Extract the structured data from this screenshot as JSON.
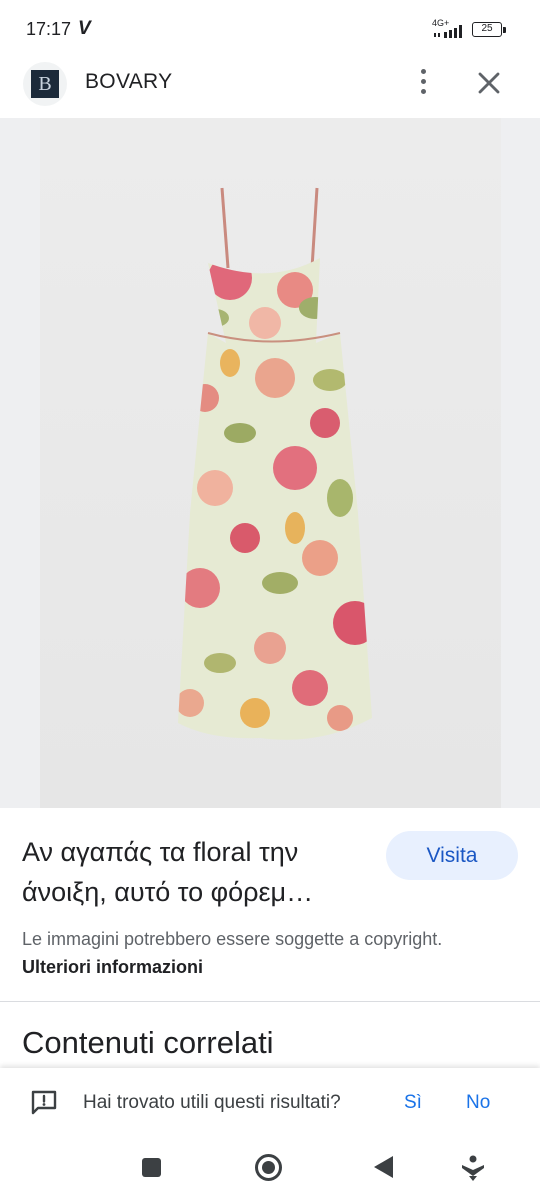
{
  "status": {
    "time": "17:17",
    "carrier_glyph": "V",
    "network": "4G+",
    "battery": "25"
  },
  "header": {
    "logo_letter": "B",
    "title": "BOVARY",
    "menu_icon": "more-vert-icon",
    "close_icon": "close-icon"
  },
  "result": {
    "caption": "Αν αγαπάς τα floral την άνοιξη, αυτό το φόρεμ…",
    "visit_label": "Visita",
    "copyright_text": "Le immagini potrebbero essere soggette a copyright.",
    "more_info_label": "Ulteriori informazioni"
  },
  "related": {
    "title": "Contenuti correlati"
  },
  "feedback": {
    "question": "Hai trovato utili questi risultati?",
    "yes_label": "Sì",
    "no_label": "No"
  },
  "colors": {
    "accent": "#1a73e8",
    "visit_bg": "#e8f0fe",
    "visit_text": "#1a57c4"
  }
}
